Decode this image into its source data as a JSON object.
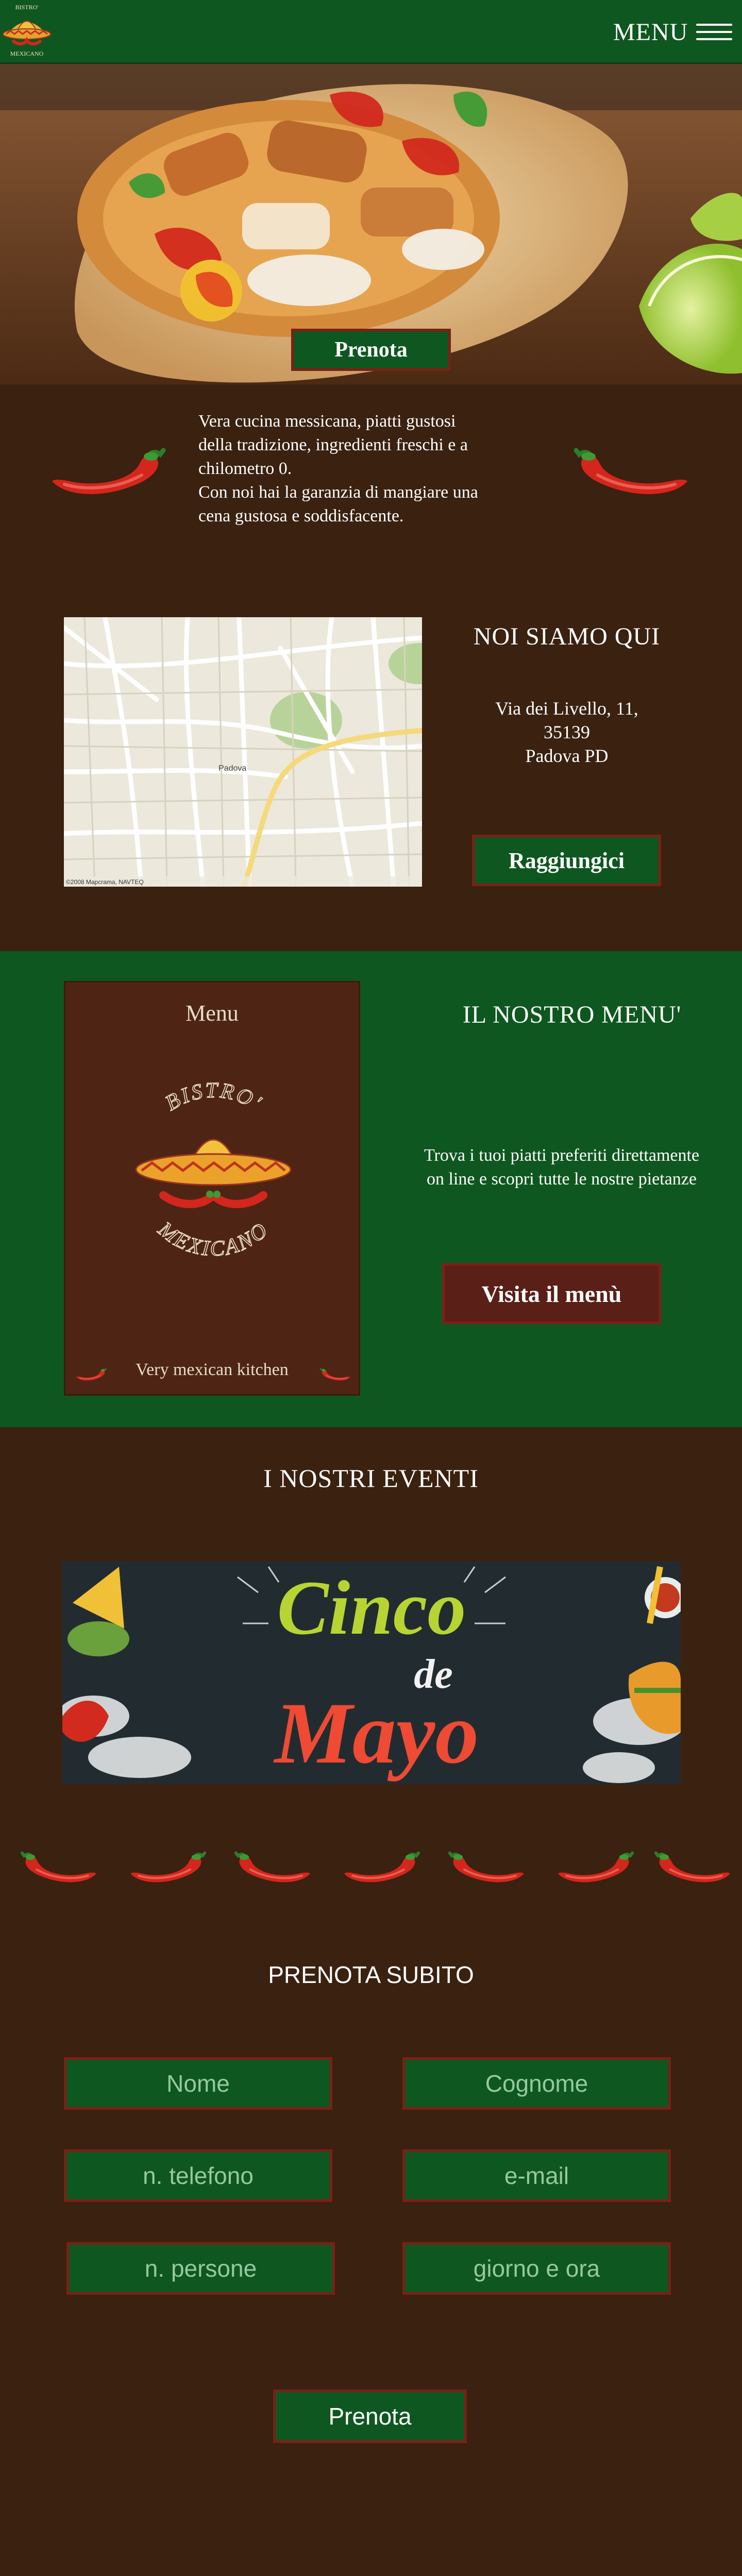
{
  "header": {
    "logo_top": "BISTRO'",
    "logo_bottom": "MEXICANO",
    "menu_label": "MENU"
  },
  "hero": {
    "button_label": "Prenota"
  },
  "intro": {
    "lines": [
      "Vera cucina messicana, piatti gustosi",
      "della tradizione, ingredienti freschi e a",
      "chilometro 0.",
      "Con noi hai la garanzia di mangiare una",
      "cena gustosa e soddisfacente."
    ]
  },
  "location": {
    "title": "NOI SIAMO QUI",
    "address_lines": [
      "Via dei Livello, 11,",
      "35139",
      "Padova PD"
    ],
    "button_label": "Raggiungici",
    "map_city_label": "Padova",
    "map_credit": "©2008 Mapcrama, NAVTEQ"
  },
  "menu_section": {
    "card_title": "Menu",
    "card_logo_top": "BISTRO'",
    "card_logo_bottom": "MEXICANO",
    "card_tagline": "Very mexican kitchen",
    "title": "IL NOSTRO MENU'",
    "description_lines": [
      "Trova i tuoi piatti preferiti direttamente",
      "on line e scopri tutte le nostre pietanze"
    ],
    "button_label": "Visita il menù"
  },
  "events": {
    "title": "I NOSTRI EVENTI",
    "banner_line1": "Cinco",
    "banner_line2": "de",
    "banner_line3": "Mayo"
  },
  "booking": {
    "title": "PRENOTA SUBITO",
    "fields": {
      "nome": "Nome",
      "cognome": "Cognome",
      "telefono": "n. telefono",
      "email": "e-mail",
      "persone": "n. persone",
      "giorno": "giorno e ora"
    },
    "button_label": "Prenota"
  },
  "colors": {
    "green": "#0f5720",
    "brown": "#3a2110",
    "red_border": "#7d1f16",
    "chili_red": "#d4261c"
  }
}
